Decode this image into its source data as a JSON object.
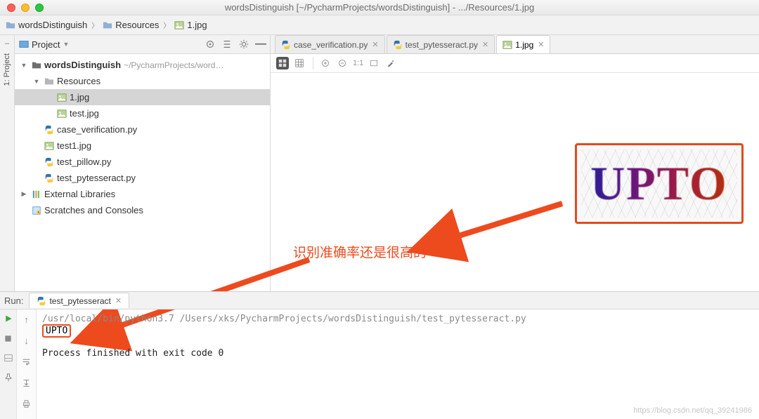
{
  "titlebar": {
    "title": "wordsDistinguish [~/PycharmProjects/wordsDistinguish] - .../Resources/1.jpg"
  },
  "breadcrumbs": [
    {
      "label": "wordsDistinguish",
      "icon": "folder"
    },
    {
      "label": "Resources",
      "icon": "folder"
    },
    {
      "label": "1.jpg",
      "icon": "image"
    }
  ],
  "left_rail": {
    "label": "1: Project"
  },
  "project_panel": {
    "title": "Project",
    "tree": [
      {
        "lvl": 1,
        "expand": "down",
        "icon": "folder-dark",
        "label": "wordsDistinguish",
        "sub": "~/PycharmProjects/word…",
        "bold": true
      },
      {
        "lvl": 2,
        "expand": "down",
        "icon": "folder-light",
        "label": "Resources"
      },
      {
        "lvl": 3,
        "icon": "image",
        "label": "1.jpg",
        "selected": true
      },
      {
        "lvl": 3,
        "icon": "image",
        "label": "test.jpg"
      },
      {
        "lvl": 2,
        "icon": "python",
        "label": "case_verification.py"
      },
      {
        "lvl": 2,
        "icon": "image",
        "label": "test1.jpg"
      },
      {
        "lvl": 2,
        "icon": "python",
        "label": "test_pillow.py"
      },
      {
        "lvl": 2,
        "icon": "python",
        "label": "test_pytesseract.py"
      },
      {
        "lvl": 1,
        "expand": "right",
        "icon": "lib",
        "label": "External Libraries"
      },
      {
        "lvl": 1,
        "icon": "scratch",
        "label": "Scratches and Consoles"
      }
    ]
  },
  "editor": {
    "tabs": [
      {
        "label": "case_verification.py",
        "icon": "python"
      },
      {
        "label": "test_pytesseract.py",
        "icon": "python"
      },
      {
        "label": "1.jpg",
        "icon": "image",
        "active": true
      }
    ],
    "toolbar_ratio": "1:1",
    "captcha_text": "UPTO"
  },
  "annotation": {
    "text": "识别准确率还是很高的"
  },
  "run": {
    "title": "Run:",
    "tab": "test_pytesseract",
    "console": {
      "command": "/usr/local/bin/python3.7 /Users/xks/PycharmProjects/wordsDistinguish/test_pytesseract.py",
      "output": "UPTO",
      "exit": "Process finished with exit code 0"
    }
  },
  "watermark": "https://blog.csdn.net/qq_39241986"
}
